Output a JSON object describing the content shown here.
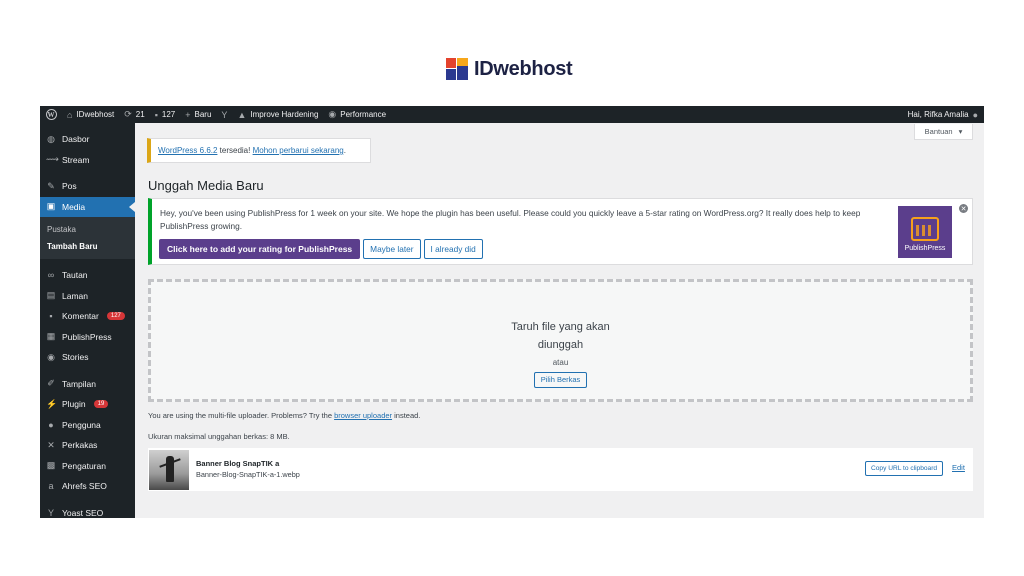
{
  "brand": {
    "name": "IDwebhost"
  },
  "adminbar": {
    "site_name": "IDwebhost",
    "updates_count": "21",
    "comments_count": "127",
    "new_label": "Baru",
    "harden_label": "Improve Hardening",
    "performance_label": "Performance",
    "greeting": "Hai, Rifka Amalia"
  },
  "sidebar": {
    "items": [
      {
        "label": "Dasbor",
        "icon": "dashboard-icon"
      },
      {
        "label": "Stream",
        "icon": "stream-icon"
      },
      {
        "label": "Pos",
        "icon": "pin-icon"
      },
      {
        "label": "Media",
        "icon": "media-icon"
      },
      {
        "label": "Tautan",
        "icon": "link-icon"
      },
      {
        "label": "Laman",
        "icon": "page-icon"
      },
      {
        "label": "Komentar",
        "icon": "comment-icon",
        "badge": "127"
      },
      {
        "label": "PublishPress",
        "icon": "calendar-icon"
      },
      {
        "label": "Stories",
        "icon": "stories-icon"
      },
      {
        "label": "Tampilan",
        "icon": "brush-icon"
      },
      {
        "label": "Plugin",
        "icon": "plugin-icon",
        "badge": "19"
      },
      {
        "label": "Pengguna",
        "icon": "users-icon"
      },
      {
        "label": "Perkakas",
        "icon": "wrench-icon"
      },
      {
        "label": "Pengaturan",
        "icon": "settings-icon"
      },
      {
        "label": "Ahrefs SEO",
        "icon": "ahrefs-icon"
      },
      {
        "label": "Yoast SEO",
        "icon": "yoast-icon"
      }
    ],
    "submenu": [
      {
        "label": "Pustaka"
      },
      {
        "label": "Tambah Baru"
      }
    ]
  },
  "help_tab": {
    "label": "Bantuan"
  },
  "update_nag": {
    "version_link": "WordPress 6.6.2",
    "text": " tersedia! ",
    "update_link": "Mohon perbarui sekarang",
    "end": "."
  },
  "page": {
    "title": "Unggah Media Baru"
  },
  "notice": {
    "text": "Hey, you've been using PublishPress for 1 week on your site. We hope the plugin has been useful. Please could you quickly leave a 5-star rating on WordPress.org? It really does help to keep PublishPress growing.",
    "primary_button": "Click here to add your rating for PublishPress",
    "later_button": "Maybe later",
    "done_button": "I already did",
    "logo_text": "PublishPress"
  },
  "dropzone": {
    "title_line1": "Taruh file yang akan",
    "title_line2": "diunggah",
    "or": "atau",
    "button": "Pilih Berkas"
  },
  "uploader_info": {
    "prefix": "You are using the multi-file uploader. Problems? Try the ",
    "link": "browser uploader",
    "suffix": " instead.",
    "max_size": "Ukuran maksimal unggahan berkas: 8 MB."
  },
  "media_item": {
    "title": "Banner Blog SnapTIK a",
    "filename": "Banner-Blog-SnapTIK-a-1.webp",
    "copy_button": "Copy URL to clipboard",
    "edit_link": "Edit"
  },
  "colors": {
    "adminbar_bg": "#1d2327",
    "accent": "#2271b1",
    "publishpress": "#5b3e8c",
    "notice_border": "#00a32a",
    "nag_border": "#dba617",
    "badge": "#d63638"
  }
}
